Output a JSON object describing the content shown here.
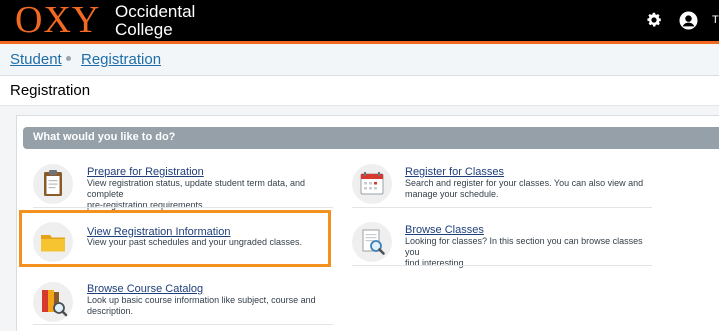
{
  "header": {
    "logo_oxy": "OXY",
    "logo_line1": "Occidental",
    "logo_line2": "College",
    "user_initial": "T",
    "icons": [
      "gear-icon",
      "user-icon"
    ]
  },
  "breadcrumb": {
    "items": [
      "Student",
      "Registration"
    ]
  },
  "page": {
    "title": "Registration"
  },
  "panel": {
    "header": "What would you like to do?"
  },
  "actions": {
    "prepare": {
      "label": "Prepare for Registration",
      "desc1": "View registration status, update student term data, and complete",
      "desc2": "pre-registration requirements.",
      "icon": "clipboard-icon"
    },
    "register": {
      "label": "Register for Classes",
      "desc1": "Search and register for your classes. You can also view and",
      "desc2": "manage your schedule.",
      "icon": "calendar-icon"
    },
    "view_info": {
      "label": "View Registration Information",
      "desc1": "View your past schedules and your ungraded classes.",
      "icon": "folder-icon"
    },
    "browse_classes": {
      "label": "Browse Classes",
      "desc1": "Looking for classes? In this section you can browse classes you",
      "desc2": "find interesting.",
      "icon": "document-search-icon"
    },
    "browse_catalog": {
      "label": "Browse Course Catalog",
      "desc1": "Look up basic course information like subject, course and",
      "desc2": "description.",
      "icon": "book-search-icon"
    }
  },
  "colors": {
    "brand_orange": "#f26922",
    "highlight": "#f3901e",
    "link": "#1f6ea8",
    "panel_header": "#95a0a9"
  }
}
